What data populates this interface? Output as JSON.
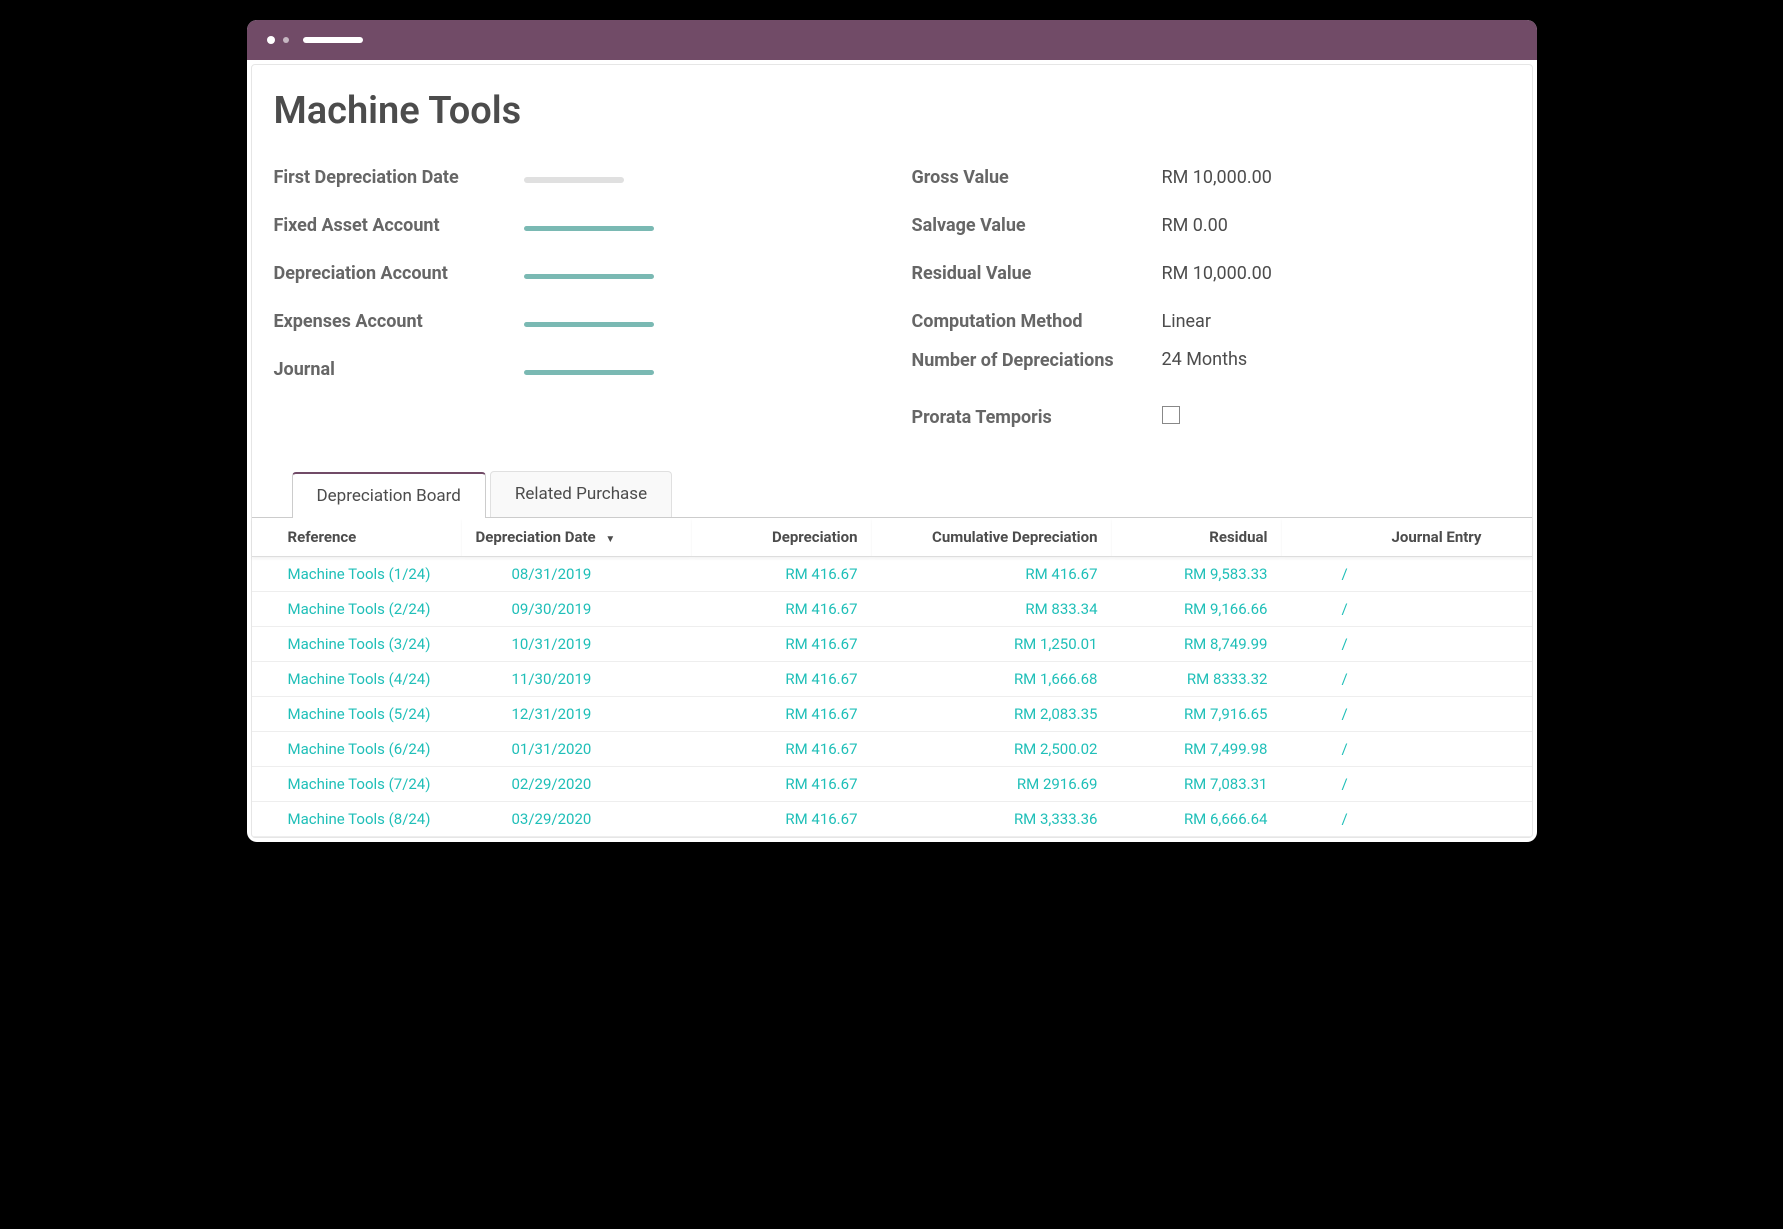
{
  "title": "Machine Tools",
  "left_fields": [
    {
      "label": "First Depreciation Date",
      "redact": "light"
    },
    {
      "label": "Fixed Asset Account",
      "redact": "teal"
    },
    {
      "label": "Depreciation Account",
      "redact": "teal"
    },
    {
      "label": "Expenses Account",
      "redact": "teal"
    },
    {
      "label": "Journal",
      "redact": "teal"
    }
  ],
  "right_fields": {
    "gross_value": {
      "label": "Gross Value",
      "value": "RM 10,000.00"
    },
    "salvage_value": {
      "label": "Salvage Value",
      "value": "RM 0.00"
    },
    "residual_value": {
      "label": "Residual Value",
      "value": "RM 10,000.00"
    },
    "computation_method": {
      "label": "Computation Method",
      "value": "Linear"
    },
    "number_of_depreciations": {
      "label": "Number of Depreciations",
      "value": "24 Months"
    },
    "prorata_temporis": {
      "label": "Prorata Temporis",
      "checked": false
    }
  },
  "tabs": {
    "depreciation_board": "Depreciation Board",
    "related_purchase": "Related Purchase"
  },
  "board": {
    "headers": {
      "reference": "Reference",
      "date": "Depreciation Date",
      "depreciation": "Depreciation",
      "cumulative": "Cumulative Depreciation",
      "residual": "Residual",
      "journal": "Journal Entry"
    },
    "rows": [
      {
        "reference": "Machine Tools (1/24)",
        "date": "08/31/2019",
        "depreciation": "RM 416.67",
        "cumulative": "RM 416.67",
        "residual": "RM 9,583.33",
        "journal": "/"
      },
      {
        "reference": "Machine Tools (2/24)",
        "date": "09/30/2019",
        "depreciation": "RM 416.67",
        "cumulative": "RM 833.34",
        "residual": "RM 9,166.66",
        "journal": "/"
      },
      {
        "reference": "Machine Tools (3/24)",
        "date": "10/31/2019",
        "depreciation": "RM 416.67",
        "cumulative": "RM 1,250.01",
        "residual": "RM 8,749.99",
        "journal": "/"
      },
      {
        "reference": "Machine Tools (4/24)",
        "date": "11/30/2019",
        "depreciation": "RM 416.67",
        "cumulative": "RM 1,666.68",
        "residual": "RM 8333.32",
        "journal": "/"
      },
      {
        "reference": "Machine Tools (5/24)",
        "date": "12/31/2019",
        "depreciation": "RM 416.67",
        "cumulative": "RM 2,083.35",
        "residual": "RM 7,916.65",
        "journal": "/"
      },
      {
        "reference": "Machine Tools (6/24)",
        "date": "01/31/2020",
        "depreciation": "RM 416.67",
        "cumulative": "RM 2,500.02",
        "residual": "RM 7,499.98",
        "journal": "/"
      },
      {
        "reference": "Machine Tools (7/24)",
        "date": "02/29/2020",
        "depreciation": "RM 416.67",
        "cumulative": "RM 2916.69",
        "residual": "RM 7,083.31",
        "journal": "/"
      },
      {
        "reference": "Machine Tools (8/24)",
        "date": "03/29/2020",
        "depreciation": "RM 416.67",
        "cumulative": "RM 3,333.36",
        "residual": "RM 6,666.64",
        "journal": "/"
      }
    ]
  }
}
